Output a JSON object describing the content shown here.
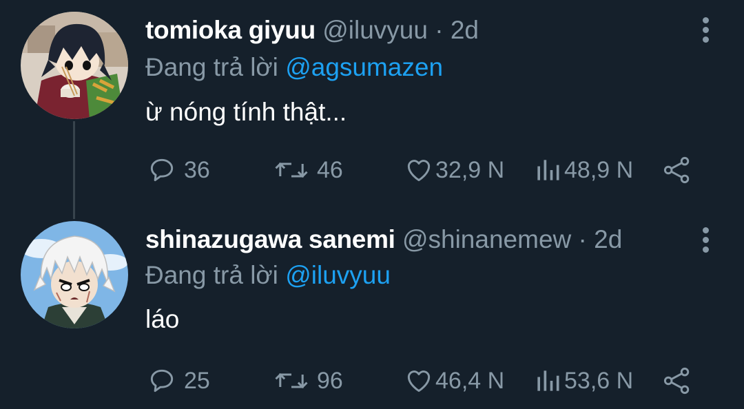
{
  "tweets": [
    {
      "name": "tomioka giyuu",
      "handle": "@iluvyuu",
      "separator": "·",
      "time": "2d",
      "reply_label": "Đang trả lời",
      "reply_to": "@agsumazen",
      "text": "ừ nóng tính thật...",
      "replies": "36",
      "retweets": "46",
      "likes": "32,9 N",
      "views": "48,9 N"
    },
    {
      "name": "shinazugawa sanemi",
      "handle": "@shinanemew",
      "separator": "·",
      "time": "2d",
      "reply_label": "Đang trả lời",
      "reply_to": "@iluvyuu",
      "text": "láo",
      "replies": "25",
      "retweets": "96",
      "likes": "46,4 N",
      "views": "53,6 N"
    }
  ],
  "icons": {
    "reply": "speech-bubble-icon",
    "retweet": "retweet-arrows-icon",
    "like": "heart-icon",
    "views": "bar-chart-icon",
    "share": "share-nodes-icon",
    "more": "vertical-dots-icon"
  },
  "colors": {
    "background": "#15202b",
    "primary_text": "#ffffff",
    "secondary_text": "#8899a6",
    "link": "#1da1f2",
    "thread_line": "#38444d"
  }
}
